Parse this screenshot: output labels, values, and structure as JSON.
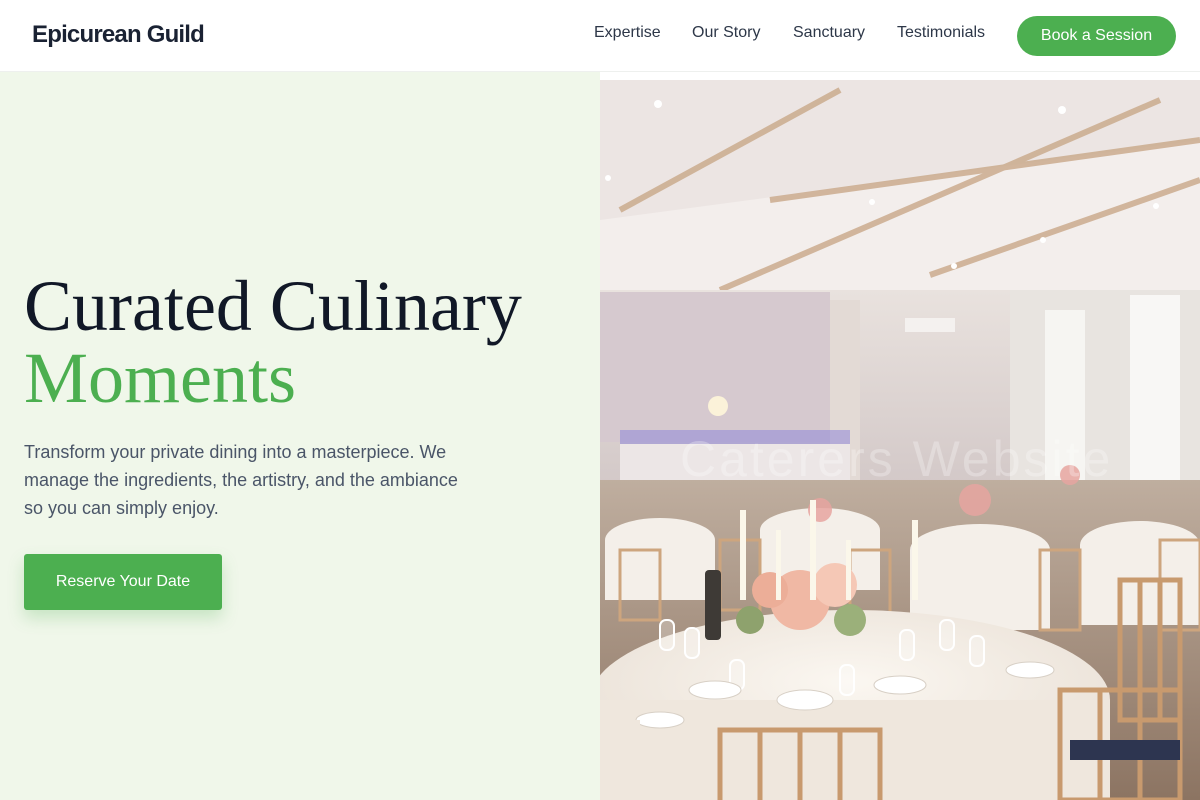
{
  "header": {
    "logo": "Epicurean Guild",
    "nav": [
      "Expertise",
      "Our Story",
      "Sanctuary",
      "Testimonials"
    ],
    "cta": "Book a Session"
  },
  "hero": {
    "title_line1": "Curated Culinary",
    "title_line2": "Moments",
    "subtitle": "Transform your private dining into a masterpiece. We manage the ingredients, the artistry, and the ambiance so you can simply enjoy.",
    "cta": "Reserve Your Date",
    "image_watermark": "Caterers Website"
  },
  "colors": {
    "accent": "#4caf50",
    "hero_bg": "#f0f7ea",
    "heading": "#111827",
    "body_text": "#4a5568"
  }
}
